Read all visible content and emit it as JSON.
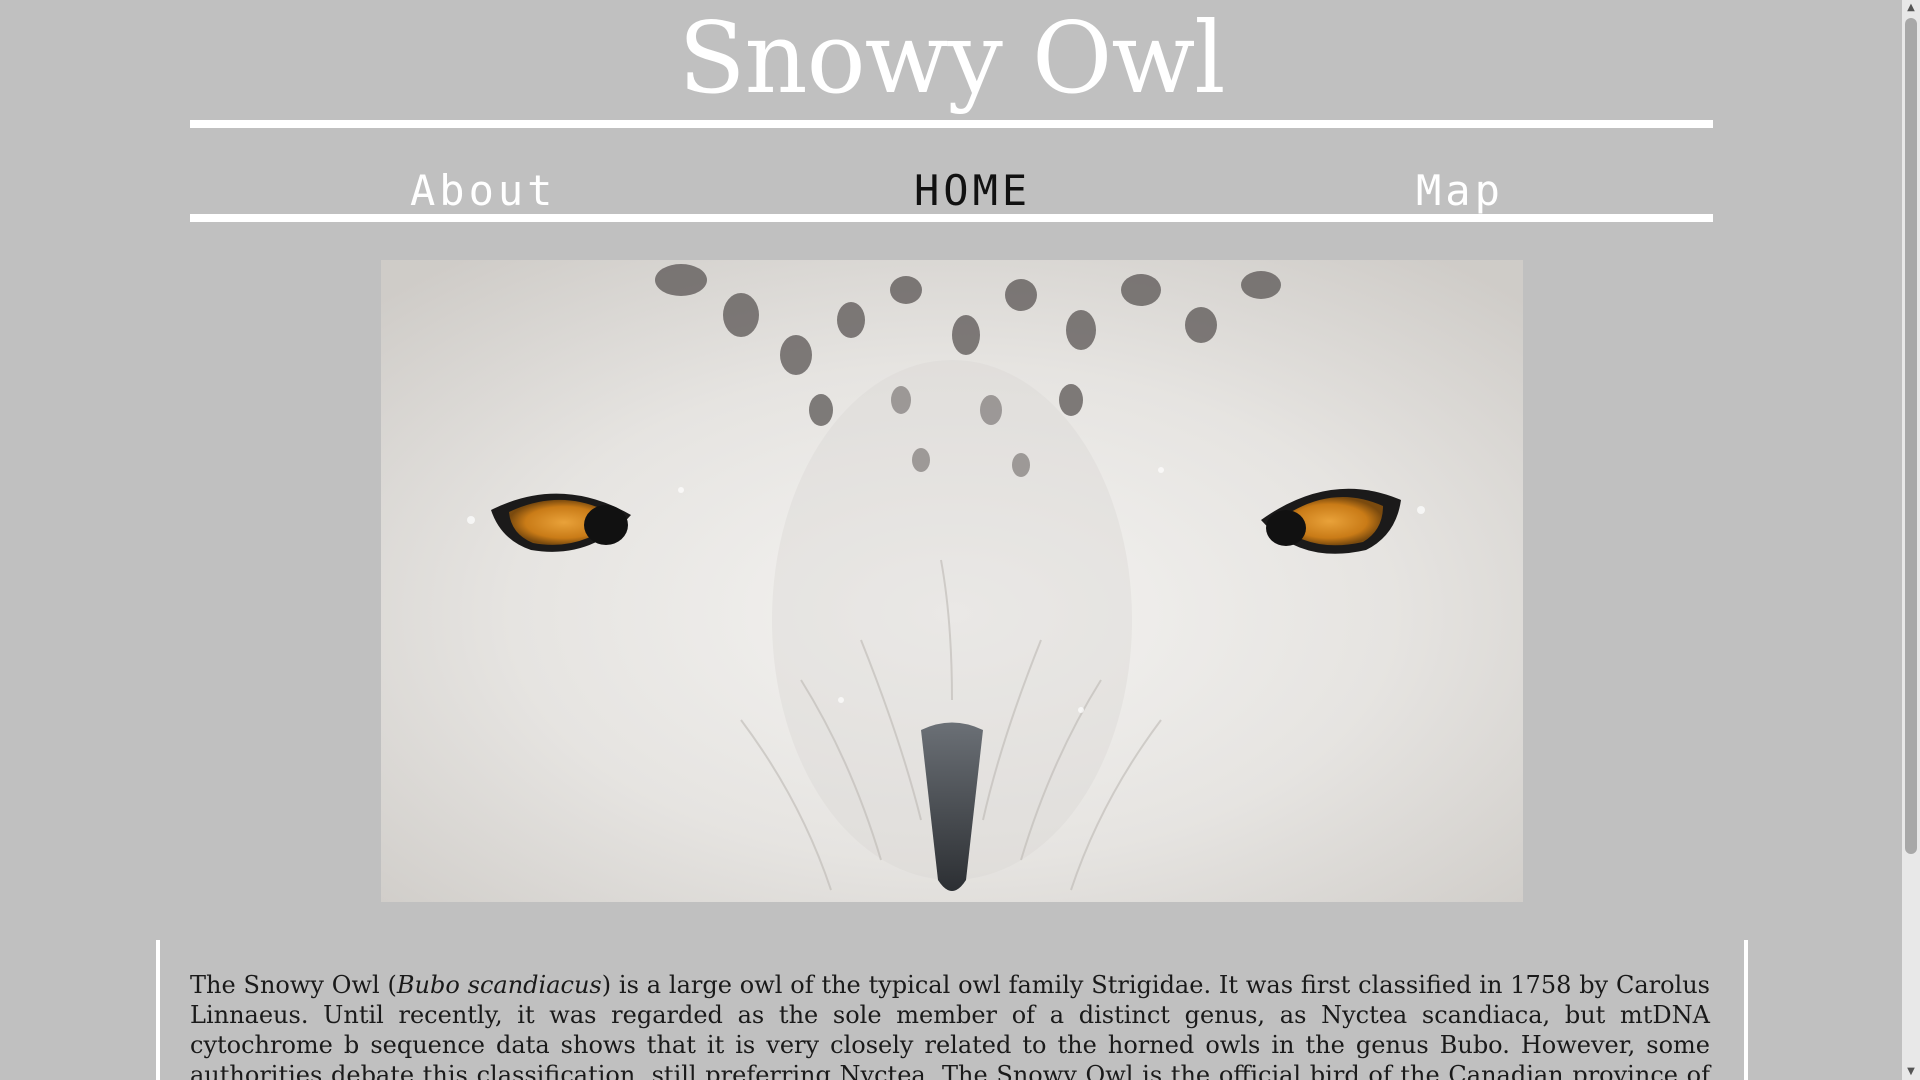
{
  "header": {
    "title": "Snowy Owl"
  },
  "nav": {
    "items": [
      {
        "label": "About"
      },
      {
        "label": "HOME"
      },
      {
        "label": "Map"
      }
    ],
    "active": "HOME"
  },
  "content": {
    "intro_before": "The Snowy Owl (",
    "intro_species": "Bubo scandiacus",
    "intro_after": ") is a large owl of the typical owl family Strigidae. It was first classified in 1758 by Carolus Linnaeus. Until recently, it was regarded as the sole member of a distinct genus, as Nyctea scandiaca, but mtDNA cytochrome b sequence data shows that it is very closely related to the horned owls in the genus Bubo. However, some authorities debate this classification, still preferring Nyctea. The Snowy Owl is the official bird of the Canadian province of Quebec. It is also widely sought after by"
  },
  "colors": {
    "background": "#c0c0c0",
    "title": "#ffffff",
    "nav_text": "#ffffff",
    "nav_active": "#111111",
    "rule": "#ffffff",
    "body_text": "#1a1a1a"
  },
  "icons": {
    "scroll_up": "▲",
    "scroll_down": "▼"
  }
}
